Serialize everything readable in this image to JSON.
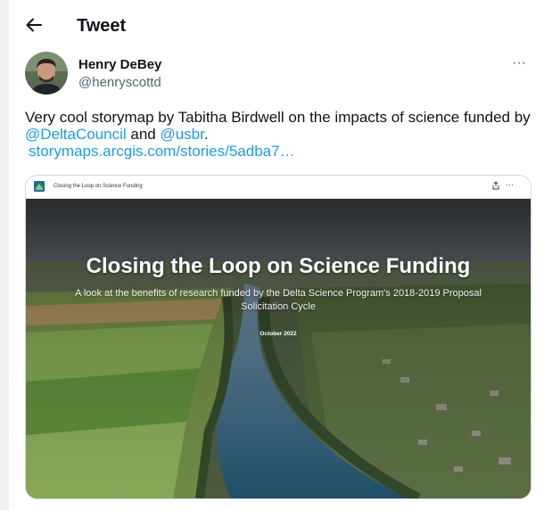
{
  "header": {
    "title": "Tweet",
    "back_icon": "arrow-left-icon"
  },
  "tweet": {
    "author": {
      "name": "Henry DeBey",
      "handle": "@henryscottd"
    },
    "more_icon": "more-horizontal-icon",
    "more_label": "···",
    "text": {
      "part1": "Very cool storymap by Tabitha Birdwell on the impacts of science funded by ",
      "mention1": "@DeltaCouncil",
      "and": " and ",
      "mention2": "@usbr",
      "period": ".",
      "link": "storymaps.arcgis.com/stories/5adba7…"
    },
    "media": {
      "bar_title": "Closing the Loop on Science Funding",
      "bar_more": "···",
      "title": "Closing the Loop on Science Funding",
      "subtitle": "A look at the benefits of research funded by the Delta Science Program's 2018-2019 Proposal Solicitation Cycle",
      "date": "October 2022"
    }
  },
  "colors": {
    "accent": "#1d9bf0",
    "text": "#0f1419",
    "secondary": "#536471",
    "border": "#cfd9de"
  }
}
